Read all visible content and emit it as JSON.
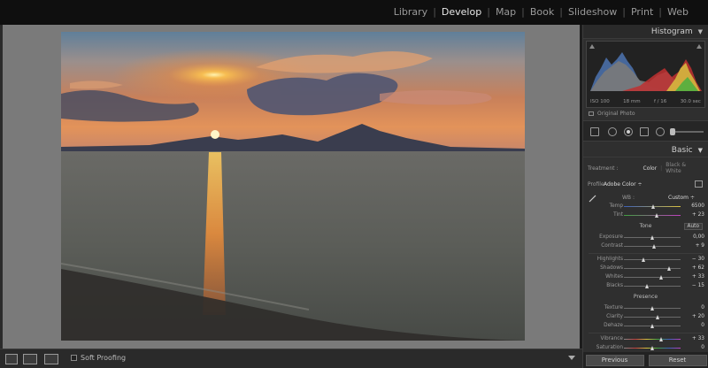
{
  "modules": [
    "Library",
    "Develop",
    "Map",
    "Book",
    "Slideshow",
    "Print",
    "Web"
  ],
  "active_module": "Develop",
  "toolbar": {
    "soft_proofing": "Soft Proofing"
  },
  "histogram": {
    "title": "Histogram",
    "exif": {
      "iso": "ISO 100",
      "focal": "18 mm",
      "aperture": "f / 16",
      "shutter": "30.0 sec"
    },
    "original": "Original Photo"
  },
  "basic": {
    "title": "Basic",
    "treatment_label": "Treatment :",
    "treatment_color": "Color",
    "treatment_bw": "Black & White",
    "profile_label": "Profile",
    "profile_value": "Adobe Color ÷",
    "wb_label": "WB :",
    "wb_value": "Custom ÷",
    "tone_label": "Tone",
    "auto_label": "Auto",
    "presence_label": "Presence"
  },
  "sliders": {
    "temp": {
      "label": "Temp",
      "value": "6500",
      "pos": 0.52
    },
    "tint": {
      "label": "Tint",
      "value": "+ 23",
      "pos": 0.58
    },
    "exposure": {
      "label": "Exposure",
      "value": "0,00",
      "pos": 0.5
    },
    "contrast": {
      "label": "Contrast",
      "value": "+ 9",
      "pos": 0.54
    },
    "highlights": {
      "label": "Highlights",
      "value": "− 30",
      "pos": 0.35
    },
    "shadows": {
      "label": "Shadows",
      "value": "+ 62",
      "pos": 0.81
    },
    "whites": {
      "label": "Whites",
      "value": "+ 33",
      "pos": 0.66
    },
    "blacks": {
      "label": "Blacks",
      "value": "− 15",
      "pos": 0.42
    },
    "texture": {
      "label": "Texture",
      "value": "0",
      "pos": 0.5
    },
    "clarity": {
      "label": "Clarity",
      "value": "+ 20",
      "pos": 0.6
    },
    "dehaze": {
      "label": "Dehaze",
      "value": "0",
      "pos": 0.5
    },
    "vibrance": {
      "label": "Vibrance",
      "value": "+ 33",
      "pos": 0.66
    },
    "saturation": {
      "label": "Saturation",
      "value": "0",
      "pos": 0.5
    }
  },
  "buttons": {
    "previous": "Previous",
    "reset": "Reset"
  },
  "colors": {
    "panel_bg": "#2f2f2f",
    "center_bg": "#7a7a7a",
    "active_text": "#e8e8e8"
  },
  "icons": [
    "loupe-view-icon",
    "compare-view-icon",
    "survey-view-icon",
    "crop-icon",
    "spot-removal-icon",
    "red-eye-icon",
    "graduated-filter-icon",
    "radial-filter-icon",
    "brush-icon",
    "eyedropper-icon",
    "profile-browser-icon"
  ]
}
